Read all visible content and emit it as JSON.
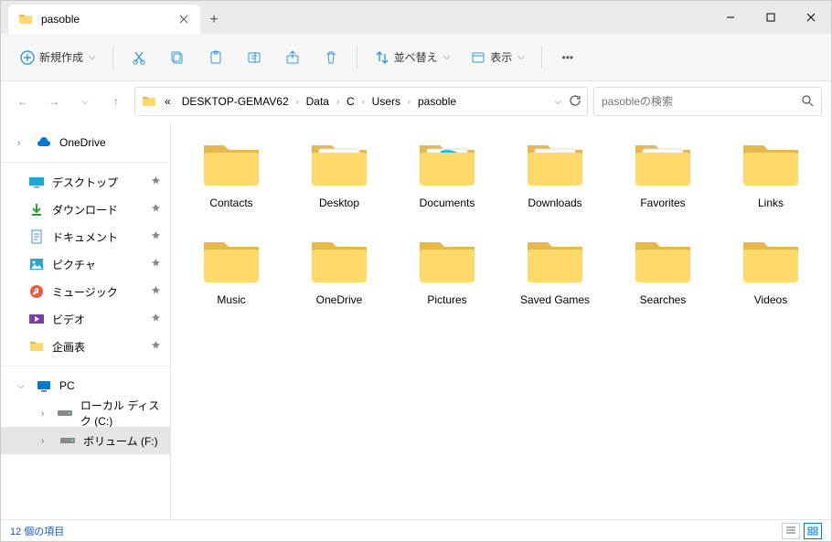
{
  "window": {
    "tab_title": "pasoble"
  },
  "toolbar": {
    "new_label": "新規作成",
    "sort_label": "並べ替え",
    "view_label": "表示"
  },
  "breadcrumb": {
    "prefix": "«",
    "parts": [
      "DESKTOP-GEMAV62",
      "Data",
      "C",
      "Users",
      "pasoble"
    ]
  },
  "search": {
    "placeholder": "pasobleの検索"
  },
  "sidebar": {
    "onedrive": "OneDrive",
    "quick": [
      {
        "label": "デスクトップ",
        "icon": "desktop"
      },
      {
        "label": "ダウンロード",
        "icon": "download"
      },
      {
        "label": "ドキュメント",
        "icon": "document"
      },
      {
        "label": "ピクチャ",
        "icon": "pictures"
      },
      {
        "label": "ミュージック",
        "icon": "music"
      },
      {
        "label": "ビデオ",
        "icon": "video"
      },
      {
        "label": "企画表",
        "icon": "folder"
      }
    ],
    "pc": "PC",
    "drives": [
      {
        "label": "ローカル ディスク (C:)"
      },
      {
        "label": "ボリューム (F:)"
      }
    ]
  },
  "folders": [
    {
      "name": "Contacts",
      "variant": "plain"
    },
    {
      "name": "Desktop",
      "variant": "desktop"
    },
    {
      "name": "Documents",
      "variant": "documents"
    },
    {
      "name": "Downloads",
      "variant": "downloads"
    },
    {
      "name": "Favorites",
      "variant": "favorites"
    },
    {
      "name": "Links",
      "variant": "plain"
    },
    {
      "name": "Music",
      "variant": "plain"
    },
    {
      "name": "OneDrive",
      "variant": "plain"
    },
    {
      "name": "Pictures",
      "variant": "plain"
    },
    {
      "name": "Saved Games",
      "variant": "plain"
    },
    {
      "name": "Searches",
      "variant": "plain"
    },
    {
      "name": "Videos",
      "variant": "plain"
    }
  ],
  "status": {
    "count_text": "12 個の項目"
  }
}
